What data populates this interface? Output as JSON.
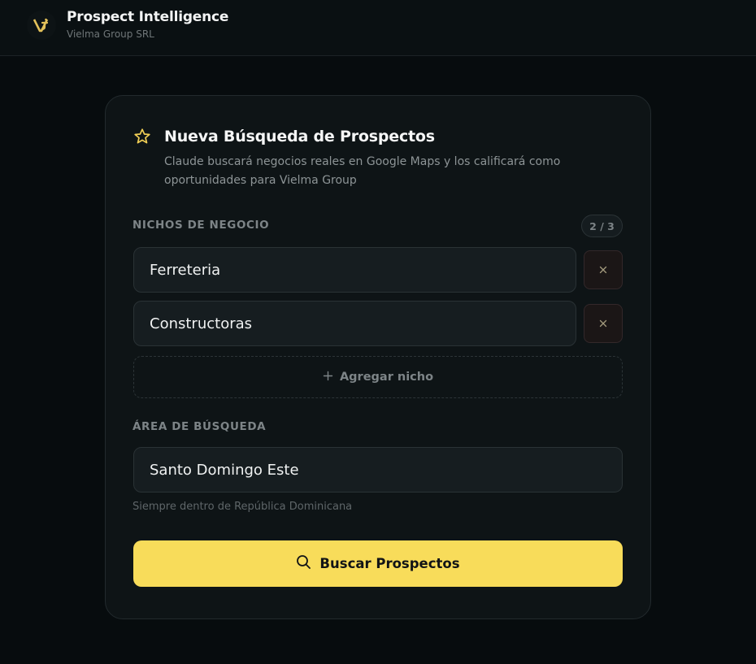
{
  "header": {
    "title": "Prospect Intelligence",
    "subtitle": "Vielma Group SRL",
    "logo_icon": "vg-monogram-logo",
    "accent_color": "#f8dc5a"
  },
  "card": {
    "icon": "star-outline-icon",
    "title": "Nueva Búsqueda de Prospectos",
    "description": "Claude buscará negocios reales en Google Maps y los calificará como oportunidades para Vielma Group"
  },
  "niches": {
    "label": "NICHOS DE NEGOCIO",
    "counter": "2 / 3",
    "items": [
      {
        "value": "Ferreteria",
        "remove_icon": "close-icon"
      },
      {
        "value": "Constructoras",
        "remove_icon": "close-icon"
      }
    ],
    "add_label": "Agregar nicho",
    "add_icon": "plus-icon"
  },
  "area": {
    "label": "ÁREA DE BÚSQUEDA",
    "value": "Santo Domingo Este",
    "hint": "Siempre dentro de República Dominicana"
  },
  "search_button": {
    "label": "Buscar Prospectos",
    "icon": "search-icon"
  }
}
